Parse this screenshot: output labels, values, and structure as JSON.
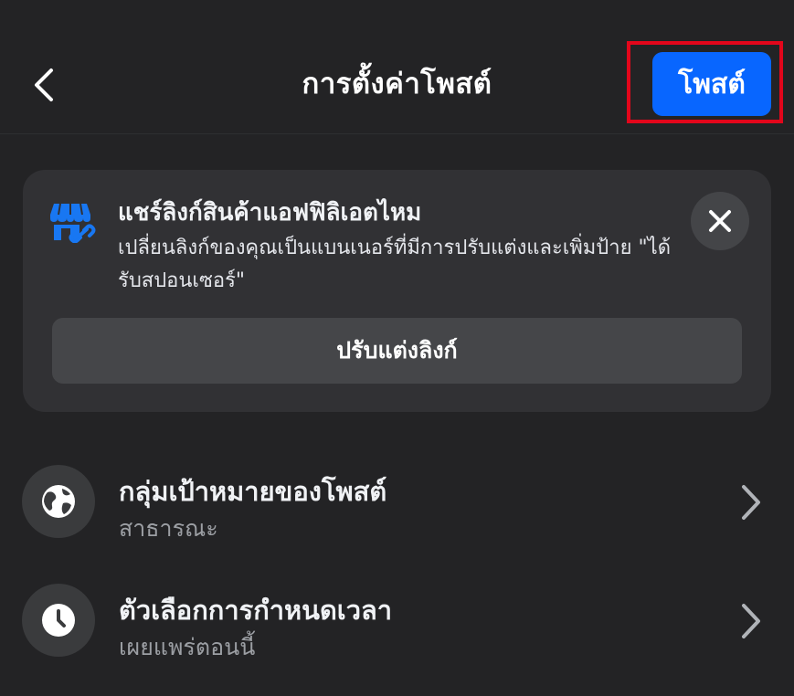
{
  "header": {
    "title": "การตั้งค่าโพสต์",
    "back_icon": "chevron-left-icon",
    "post_label": "โพสต์",
    "highlight_color": "#e3061b",
    "accent_color": "#0866ff"
  },
  "affiliate_card": {
    "icon": "storefront-link-icon",
    "title": "แชร์ลิงก์สินค้าแอฟฟิลิเอตไหม",
    "body": "เปลี่ยนลิงก์ของคุณเป็นแบนเนอร์ที่มีการปรับแต่งและเพิ่มป้าย \"ได้รับสปอนเซอร์\"",
    "close_icon": "close-icon",
    "customize_label": "ปรับแต่งลิงก์"
  },
  "settings": [
    {
      "icon": "globe-icon",
      "title": "กลุ่มเป้าหมายของโพสต์",
      "subtitle": "สาธารณะ"
    },
    {
      "icon": "clock-icon",
      "title": "ตัวเลือกการกำหนดเวลา",
      "subtitle": "เผยแพร่ตอนนี้"
    }
  ]
}
